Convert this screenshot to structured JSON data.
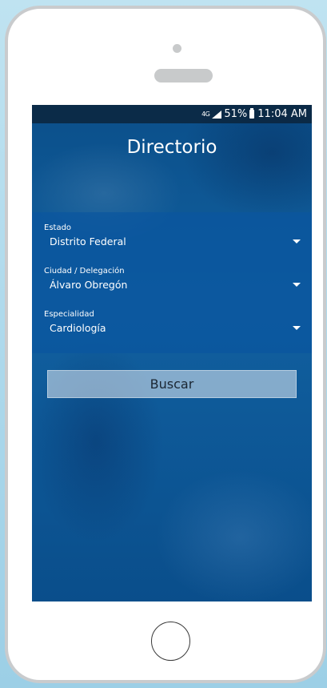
{
  "status_bar": {
    "network": "4G",
    "battery": "51%",
    "time": "11:04 AM"
  },
  "header": {
    "title": "Directorio"
  },
  "form": {
    "estado": {
      "label": "Estado",
      "value": "Distrito Federal"
    },
    "ciudad": {
      "label": "Ciudad / Delegación",
      "value": "Álvaro Obregón"
    },
    "especialidad": {
      "label": "Especialidad",
      "value": "Cardiología"
    }
  },
  "actions": {
    "search_label": "Buscar"
  },
  "icons": {
    "dropdown": "chevron-down-icon",
    "signal": "signal-icon",
    "battery": "battery-icon",
    "home": "home-button-icon"
  },
  "colors": {
    "background": "#0b4f8a",
    "form_band": "#0a56a0",
    "button": "#e6ecf4",
    "text_light": "#ffffff",
    "text_dark": "#1b2733"
  }
}
